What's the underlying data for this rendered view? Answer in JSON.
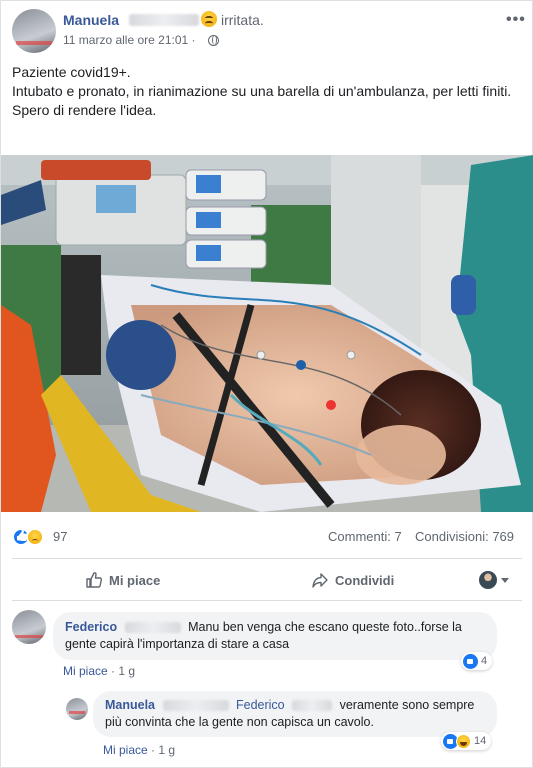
{
  "post": {
    "author": "Manuela",
    "feeling": "irritata.",
    "timestamp": "11 marzo alle ore 21:01 ·",
    "text_lines": [
      "Paziente covid19+.",
      "Intubato e pronato, in rianimazione su una barella di un'ambulanza, per letti finiti.",
      "Spero di rendere l'idea."
    ],
    "more_label": "•••",
    "reactions_count": "97",
    "comments_label": "Commenti: 7",
    "shares_label": "Condivisioni: 769"
  },
  "actions": {
    "like_label": "Mi piace",
    "share_label": "Condividi"
  },
  "comments": [
    {
      "author": "Federico",
      "text": "Manu ben venga che escano queste foto..forse la gente capirà l'importanza di stare a casa",
      "like_label": "Mi piace",
      "age": "· 1 g",
      "reaction_count": "4"
    },
    {
      "author": "Manuela",
      "mention": "Federico",
      "text": "veramente sono sempre più convinta che la gente non capisca un cavolo.",
      "like_label": "Mi piace",
      "age": "· 1 g",
      "reaction_count": "14"
    }
  ],
  "colors": {
    "link": "#385898",
    "meta": "#606770",
    "like_blue": "#1877f2",
    "bubble": "#f2f3f5"
  }
}
